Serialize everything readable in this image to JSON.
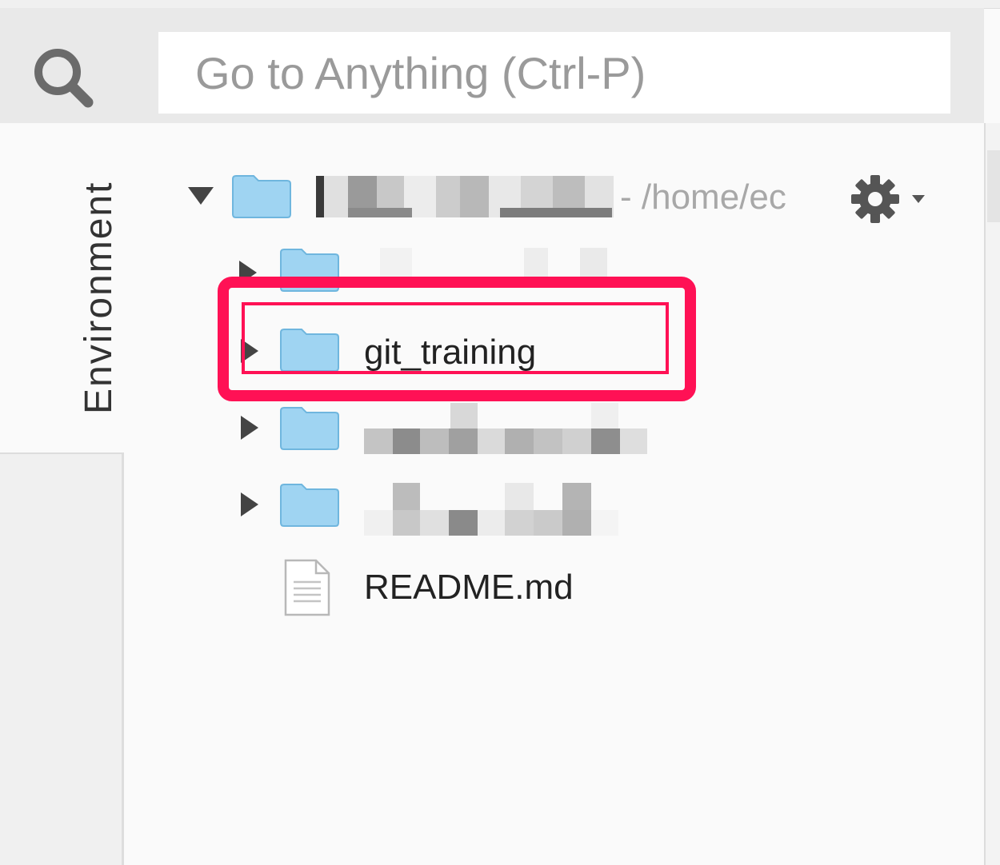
{
  "search": {
    "placeholder": "Go to Anything (Ctrl-P)",
    "icon": "search-icon"
  },
  "sidebar": {
    "tab_label": "Environment"
  },
  "tree": {
    "root": {
      "path_suffix": "- /home/ec",
      "expanded": true
    },
    "items": [
      {
        "label": "",
        "type": "folder",
        "expanded": false,
        "redacted": true
      },
      {
        "label": "git_training",
        "type": "folder",
        "expanded": false,
        "highlighted": true
      },
      {
        "label": "",
        "type": "folder",
        "expanded": false,
        "redacted": true
      },
      {
        "label": "",
        "type": "folder",
        "expanded": false,
        "redacted": true
      },
      {
        "label": "README.md",
        "type": "file"
      }
    ]
  },
  "colors": {
    "folder": "#9fd4f2",
    "highlight": "#ff1155"
  }
}
